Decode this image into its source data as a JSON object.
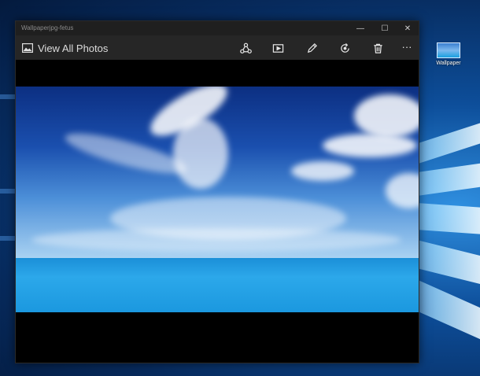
{
  "window": {
    "title": "Wallpaperjpg-fetus",
    "minimize_glyph": "—",
    "maximize_glyph": "☐",
    "close_glyph": "✕"
  },
  "toolbar": {
    "view_all_label": "View All Photos",
    "buttons": [
      {
        "name": "share-button",
        "icon": "share-icon"
      },
      {
        "name": "slideshow-button",
        "icon": "slideshow-icon"
      },
      {
        "name": "edit-button",
        "icon": "pencil-icon"
      },
      {
        "name": "rotate-button",
        "icon": "rotate-icon"
      },
      {
        "name": "delete-button",
        "icon": "trash-icon"
      },
      {
        "name": "more-button",
        "icon": "more-icon",
        "glyph": "···"
      }
    ]
  },
  "desktop": {
    "icon_label": "Wallpaper"
  },
  "colors": {
    "titlebar": "#1f1f1f",
    "toolbar": "#262626",
    "desktop_accent": "#0d4e9a"
  }
}
